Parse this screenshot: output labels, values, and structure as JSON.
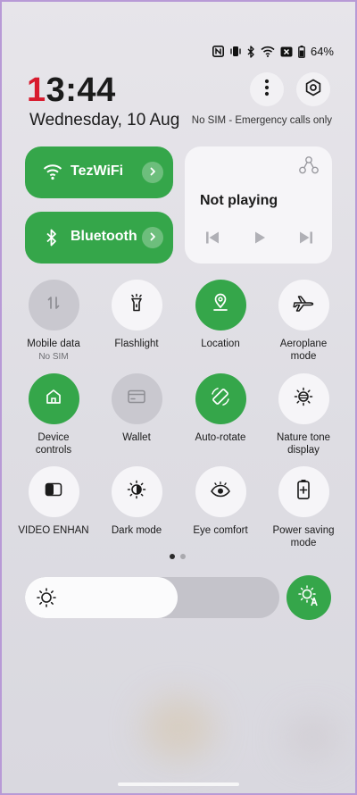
{
  "status_bar": {
    "battery_percent": "64%",
    "icons": [
      "nfc-icon",
      "vibrate-icon",
      "bluetooth-icon",
      "wifi-icon",
      "no-sim-icon",
      "battery-icon"
    ]
  },
  "clock": {
    "hour_first_digit": "1",
    "rest": "3:44"
  },
  "date": "Wednesday, 10 Aug",
  "sim_status": "No SIM - Emergency calls only",
  "top_actions": [
    "more-icon",
    "settings-icon"
  ],
  "wifi": {
    "label": "TezWiFi",
    "active": true
  },
  "bluetooth": {
    "label": "Bluetooth",
    "active": true
  },
  "media": {
    "status": "Not playing",
    "controls": [
      "previous-icon",
      "play-icon",
      "next-icon"
    ]
  },
  "tiles": [
    {
      "label": "Mobile data",
      "sub": "No SIM",
      "state": "unavailable",
      "icon": "mobile-data-icon"
    },
    {
      "label": "Flashlight",
      "state": "off",
      "icon": "flashlight-icon"
    },
    {
      "label": "Location",
      "state": "on",
      "icon": "location-icon"
    },
    {
      "label": "Aeroplane\nmode",
      "state": "off",
      "icon": "airplane-icon"
    },
    {
      "label": "Device\ncontrols",
      "state": "on",
      "icon": "home-icon"
    },
    {
      "label": "Wallet",
      "state": "unavailable",
      "icon": "wallet-icon"
    },
    {
      "label": "Auto-rotate",
      "state": "on",
      "icon": "auto-rotate-icon"
    },
    {
      "label": "Nature tone\ndisplay",
      "state": "off",
      "icon": "nature-tone-icon"
    },
    {
      "label": "VIDEO ENHAN",
      "state": "off",
      "icon": "video-enhance-icon"
    },
    {
      "label": "Dark mode",
      "state": "off",
      "icon": "dark-mode-icon"
    },
    {
      "label": "Eye comfort",
      "state": "off",
      "icon": "eye-icon"
    },
    {
      "label": "Power saving\nmode",
      "state": "off",
      "icon": "battery-saver-icon"
    }
  ],
  "pager": {
    "pages": 2,
    "current": 1
  },
  "brightness": {
    "level": 0.6,
    "auto": true
  },
  "colors": {
    "accent": "#35a64a",
    "clock_accent": "#d81b2e",
    "tile_off": "#f6f5f8",
    "tile_unavailable": "#c9c8cf"
  }
}
